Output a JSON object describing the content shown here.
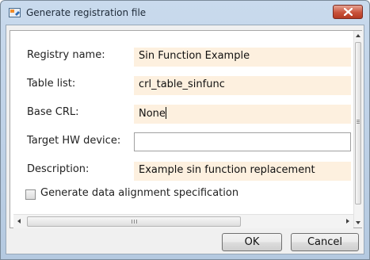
{
  "window": {
    "title": "Generate registration file"
  },
  "form": {
    "fields": [
      {
        "label": "Registry name:",
        "value": "Sin Function Example"
      },
      {
        "label": "Table list:",
        "value": "crl_table_sinfunc"
      },
      {
        "label": "Base CRL:",
        "value": "None"
      },
      {
        "label": "Target HW device:",
        "value": ""
      },
      {
        "label": "Description:",
        "value": "Example sin function replacement"
      }
    ],
    "checkbox": {
      "label": "Generate data alignment specification",
      "checked": false
    }
  },
  "scrollbar": {
    "horizontal_grip": "III"
  },
  "buttons": {
    "ok": "OK",
    "cancel": "Cancel"
  },
  "colors": {
    "titlebar": "#c4d7ec",
    "field_highlight": "#fdf0df",
    "close_button": "#c9523b"
  },
  "icons": [
    "app-icon",
    "close-icon",
    "scroll-up-icon",
    "scroll-down-icon",
    "scroll-left-icon",
    "scroll-right-icon"
  ]
}
